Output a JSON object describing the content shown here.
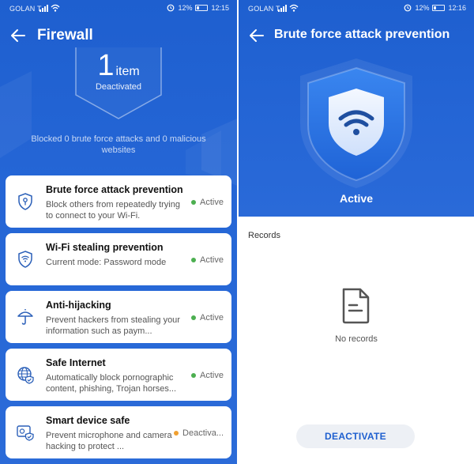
{
  "left": {
    "status_bar": {
      "carrier": "GOLAN T",
      "battery": "12%",
      "time": "12:15"
    },
    "title": "Firewall",
    "hero": {
      "count": "1",
      "unit": "item",
      "label": "Deactivated"
    },
    "summary": "Blocked 0 brute force attacks and 0 malicious websites",
    "cards": [
      {
        "title": "Brute force attack prevention",
        "subtitle": "Block others from repeatedly trying to connect to your Wi-Fi.",
        "status": "Active",
        "icon": "lock-shield-icon"
      },
      {
        "title": "Wi-Fi stealing prevention",
        "subtitle": "Current mode: Password mode",
        "status": "Active",
        "icon": "wifi-shield-icon"
      },
      {
        "title": "Anti-hijacking",
        "subtitle": "Prevent hackers from stealing your information such as paym...",
        "status": "Active",
        "icon": "umbrella-icon"
      },
      {
        "title": "Safe Internet",
        "subtitle": "Automatically block pornographic content, phishing, Trojan horses...",
        "status": "Active",
        "icon": "globe-shield-icon"
      },
      {
        "title": "Smart device safe",
        "subtitle": "Prevent microphone and camera hacking to protect ...",
        "status": "Deactiva...",
        "icon": "camera-shield-icon"
      }
    ]
  },
  "right": {
    "status_bar": {
      "carrier": "GOLAN T",
      "battery": "12%",
      "time": "12:16"
    },
    "title": "Brute force attack prevention",
    "state": "Active",
    "records_label": "Records",
    "empty_text": "No records",
    "deactivate_label": "DEACTIVATE"
  },
  "colors": {
    "primary_blue": "#1e5fcf",
    "active_green": "#4caf50",
    "inactive_orange": "#f0a030",
    "card_bg": "#ffffff"
  }
}
